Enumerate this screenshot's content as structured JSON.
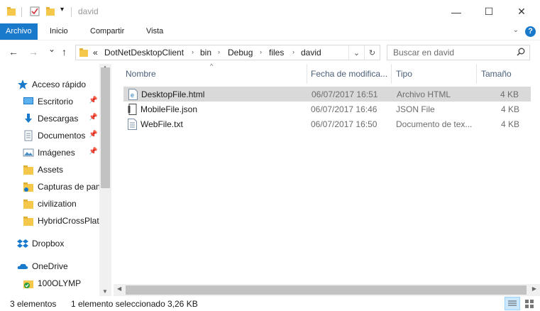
{
  "window": {
    "title": "david",
    "minimize": "—",
    "maximize": "☐",
    "close": "✕"
  },
  "ribbon": {
    "tabs": [
      {
        "label": "Archivo"
      },
      {
        "label": "Inicio"
      },
      {
        "label": "Compartir"
      },
      {
        "label": "Vista"
      }
    ],
    "help": "?"
  },
  "nav": {
    "back": "←",
    "forward": "→",
    "recent": "⌄",
    "up": "↑",
    "address_prefix": "«",
    "breadcrumbs": [
      "DotNetDesktopClient",
      "bin",
      "Debug",
      "files",
      "david"
    ],
    "search_placeholder": "Buscar en david"
  },
  "sidebar": {
    "items": [
      {
        "label": "Acceso rápido",
        "icon": "star-icon",
        "pinned": false
      },
      {
        "label": "Escritorio",
        "icon": "desktop-icon",
        "pinned": true
      },
      {
        "label": "Descargas",
        "icon": "download-icon",
        "pinned": true
      },
      {
        "label": "Documentos",
        "icon": "documents-icon",
        "pinned": true
      },
      {
        "label": "Imágenes",
        "icon": "pictures-icon",
        "pinned": true
      },
      {
        "label": "Assets",
        "icon": "folder-icon",
        "pinned": false
      },
      {
        "label": "Capturas de pan",
        "icon": "folder-sync-icon",
        "pinned": false
      },
      {
        "label": "civilization",
        "icon": "folder-icon",
        "pinned": false
      },
      {
        "label": "HybridCrossPlat",
        "icon": "folder-icon",
        "pinned": false
      },
      {
        "label": "Dropbox",
        "icon": "dropbox-icon",
        "pinned": false
      },
      {
        "label": "OneDrive",
        "icon": "onedrive-icon",
        "pinned": false
      },
      {
        "label": "100OLYMP",
        "icon": "folder-check-icon",
        "pinned": false
      }
    ]
  },
  "list": {
    "columns": {
      "name": "Nombre",
      "date": "Fecha de modifica...",
      "type": "Tipo",
      "size": "Tamaño"
    },
    "rows": [
      {
        "name": "DesktopFile.html",
        "date": "06/07/2017 16:51",
        "type": "Archivo HTML",
        "size": "4 KB",
        "icon": "html-file-icon",
        "selected": true
      },
      {
        "name": "MobileFile.json",
        "date": "06/07/2017 16:46",
        "type": "JSON File",
        "size": "4 KB",
        "icon": "json-file-icon",
        "selected": false
      },
      {
        "name": "WebFile.txt",
        "date": "06/07/2017 16:50",
        "type": "Documento de tex...",
        "size": "4 KB",
        "icon": "text-file-icon",
        "selected": false
      }
    ]
  },
  "status": {
    "count": "3 elementos",
    "selection": "1 elemento seleccionado",
    "size": "3,26 KB"
  },
  "colors": {
    "accent": "#1979ca",
    "selected_row": "#d9d9d9",
    "folder": "#f5c84c"
  }
}
